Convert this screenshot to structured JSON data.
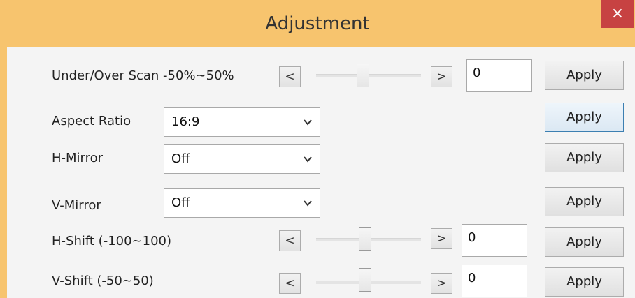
{
  "window": {
    "title": "Adjustment",
    "close_glyph": "×"
  },
  "rows": {
    "scan": {
      "label": "Under/Over Scan -50%~50%",
      "dec_glyph": "<",
      "inc_glyph": ">",
      "value": "0",
      "apply_label": "Apply"
    },
    "aspect": {
      "label": "Aspect Ratio",
      "selected": "16:9",
      "apply_label": "Apply"
    },
    "hmirror": {
      "label": "H-Mirror",
      "selected": "Off",
      "apply_label": "Apply"
    },
    "vmirror": {
      "label": "V-Mirror",
      "selected": "Off",
      "apply_label": "Apply"
    },
    "hshift": {
      "label": "H-Shift (-100~100)",
      "dec_glyph": "<",
      "inc_glyph": ">",
      "value": "0",
      "apply_label": "Apply"
    },
    "vshift": {
      "label": "V-Shift (-50~50)",
      "dec_glyph": "<",
      "inc_glyph": ">",
      "value": "0",
      "apply_label": "Apply"
    }
  },
  "icons": {
    "close": "close-icon",
    "dropdown": "chevron-down-icon"
  },
  "colors": {
    "titlebar": "#f7c46e",
    "close_button": "#c74242",
    "focused_border": "#3c7fb1"
  }
}
